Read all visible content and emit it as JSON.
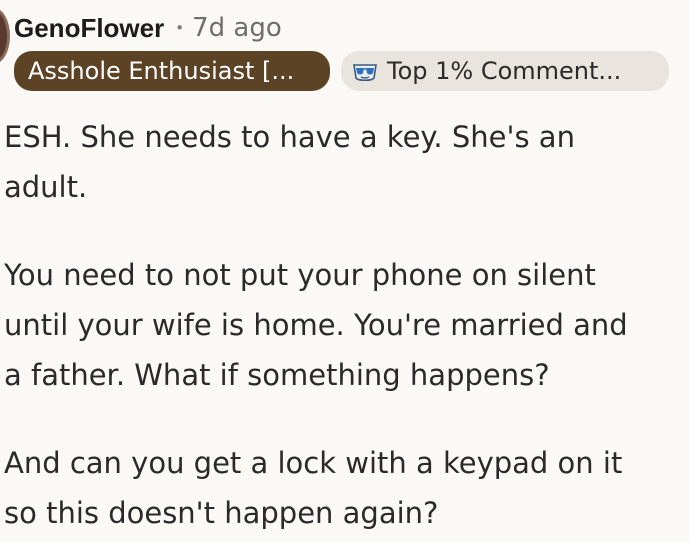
{
  "comment": {
    "username": "GenoFlower",
    "separator": "•",
    "timestamp": "7d ago",
    "flair": "Asshole Enthusiast [...",
    "award": {
      "icon": "sunglasses-award-icon",
      "label": "Top 1% Comment..."
    },
    "paragraphs": [
      "ESH. She needs to have a key. She's an\nadult.",
      "You need to not put your phone on silent\nuntil your wife is home. You're married and\na father. What if something happens?",
      "And can you get a lock with a keypad on it\nso this doesn't happen again?"
    ]
  },
  "colors": {
    "background": "#fbf9f6",
    "flair_background": "#5c4326",
    "award_background": "#e9e4dd",
    "text": "#2a2a2a",
    "meta_text": "#6e6e6e"
  }
}
